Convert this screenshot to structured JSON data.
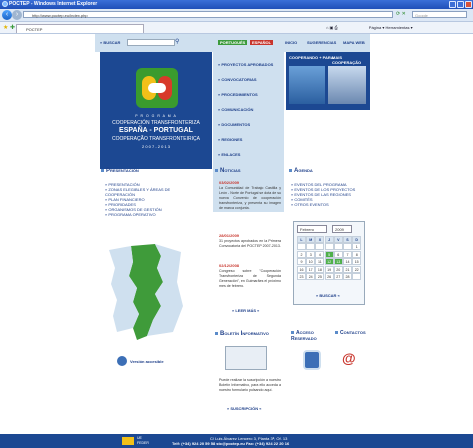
{
  "browser": {
    "title": "POCTEP - Windows Internet Explorer",
    "url": "http://www.poctep.eu/index.php",
    "search_placeholder": "Google",
    "favorite_tab": "POCTEP",
    "toolbar_right": "Página ▾   Herramientas ▾"
  },
  "header": {
    "search_label": "» BUSCAR",
    "lang_pt": "PORTUGUÊS",
    "lang_es": "ESPAÑOL",
    "top_links": [
      "INICIO",
      "SUGERENCIAS",
      "MAPA WEB"
    ]
  },
  "hero": {
    "programa": "P R O G R A M A",
    "line1": "COOPERACIÓN TRANSFRONTERIZA",
    "line2": "ESPAÑA - PORTUGAL",
    "line3": "COOPERAÇÃO TRANSFRONTEIRIÇA",
    "years": "2 0 0 7 - 2 0 1 3"
  },
  "menu": {
    "items": [
      "» PROYECTOS APROBADOS",
      "» CONVOCATORIAS",
      "» PROCEDIMIENTOS",
      "» COMUNICACIÓN",
      "» DOCUMENTOS",
      "» REGIONES",
      "» ENLACES"
    ]
  },
  "promo": {
    "title_left": "COOPERANDO + PARA",
    "title_right": "MAIS COOPERAÇÃO"
  },
  "presentacion": {
    "heading": "Presentación",
    "items": [
      "» PRESENTACIÓN",
      "» ZONAS ELEGIBLES Y ÁREAS DE",
      "   COOPERACIÓN",
      "» PLAN FINANCIERO",
      "» PRIORIDADES",
      "» ORGANISMOS DE GESTIÓN",
      "» PROGRAMA OPERATIVO"
    ],
    "accessible": "Versión accesible"
  },
  "noticias": {
    "heading": "Noticias",
    "news": [
      {
        "date": "03/02/2009",
        "text": "La Comunidad de Trabajo Castilla y León - Norte de Portugal se dota de su nueva Convenio de cooperación transfronteriza, y presenta su imagen de marca conjunta."
      },
      {
        "date": "28/01/2009",
        "text": "31 proyectos aprobados en la Primera Convocatoria del POCTEP 2007-2013."
      },
      {
        "date": "02/12/2008",
        "text": "Congreso sobre \"Cooperación Transfronteriza de Segunda Generación\", en Guimarães el próximo mes de febrero."
      }
    ],
    "more": "» LEER MÁS «"
  },
  "boletin": {
    "heading": "Boletín Informativo",
    "text": "Puede realizar la suscripción a nuestro Boletín Informativo, para ello acceda a nuestro formulario pulsando aquí.",
    "link": "» SUSCRIPCIÓN «"
  },
  "agenda": {
    "heading": "Agenda",
    "items": [
      "» EVENTOS DEL PROGRAMA",
      "» EVENTOS DE LOS PROYECTOS",
      "» EVENTOS DE LAS REGIONES",
      "» COMITÉS",
      "» OTROS EVENTOS"
    ],
    "month": "Febrero",
    "year": "2009",
    "weekdays": [
      "L",
      "M",
      "X",
      "J",
      "V",
      "S",
      "D"
    ],
    "weeks": [
      [
        "",
        "",
        "",
        "",
        "",
        "",
        "1"
      ],
      [
        "2",
        "3",
        "4",
        "5",
        "6",
        "7",
        "8"
      ],
      [
        "9",
        "10",
        "11",
        "12",
        "13",
        "14",
        "15"
      ],
      [
        "16",
        "17",
        "18",
        "19",
        "20",
        "21",
        "22"
      ],
      [
        "23",
        "24",
        "25",
        "26",
        "27",
        "28",
        ""
      ]
    ],
    "search_btn": "» BUSCAR «"
  },
  "access": {
    "reserved": "Acceso Reservado",
    "contacts": "Contactos"
  },
  "footer": {
    "address": "C/ Luis Álvarez Lencero 3, Planta 3ª, Of. 13",
    "phones": "Telf: (+34) 924 20 59 58    stc@poctep.eu    Fax: (+34) 924 22 20 16",
    "eu_label": "UE",
    "feder": "FEDER"
  },
  "colors": {
    "brand_blue": "#1c4892",
    "accent_green": "#3c9b3c",
    "accent_red": "#c8352c"
  }
}
